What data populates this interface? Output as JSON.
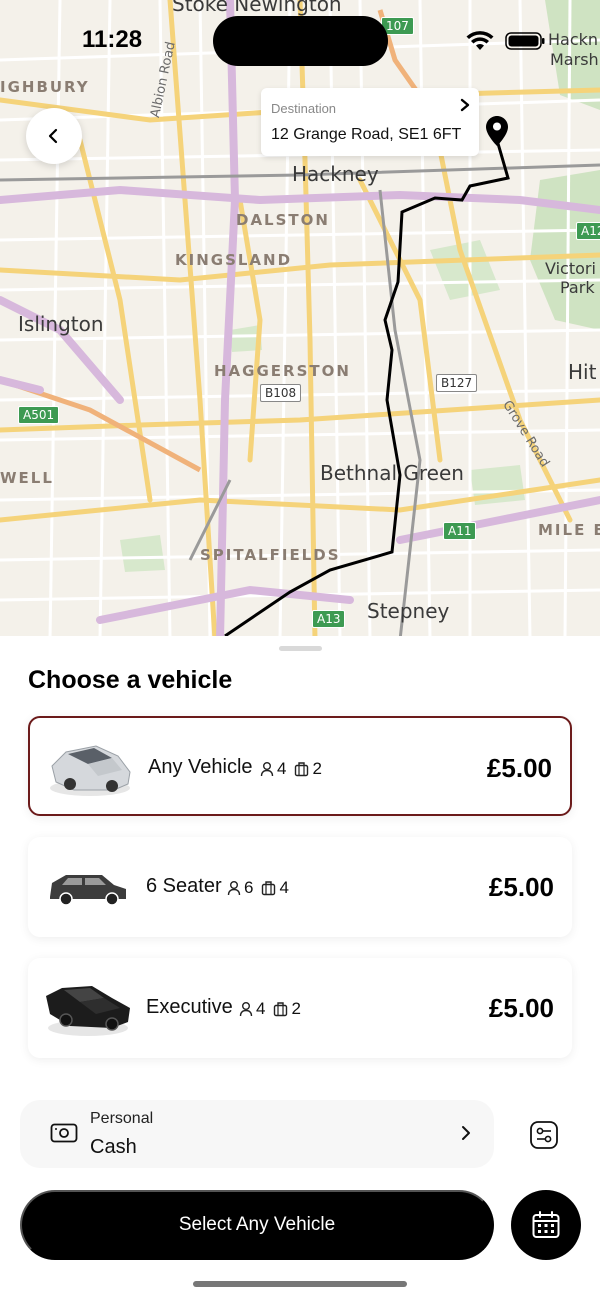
{
  "status_bar": {
    "time": "11:28"
  },
  "map": {
    "places": [
      "Stoke Newington",
      "Hackney",
      "Islington",
      "Bethnal Green",
      "Stepney",
      "Hackn",
      "Marsh",
      "Victori",
      "Park",
      "Hit"
    ],
    "areas": [
      "IGHBURY",
      "DALSTON",
      "KINGSLAND",
      "HAGGERSTON",
      "SPITALFIELDS",
      "WELL",
      "MILE E"
    ],
    "roads": [
      "Albion Road",
      "Grove Road"
    ],
    "badges": [
      "107",
      "B108",
      "B127",
      "A501",
      "A11",
      "A13",
      "A12",
      "A11"
    ]
  },
  "destination": {
    "label": "Destination",
    "value": "12 Grange Road, SE1 6FT"
  },
  "sheet": {
    "title": "Choose a vehicle",
    "vehicles": [
      {
        "name": "Any Vehicle",
        "passengers": "4",
        "luggage": "2",
        "price": "£5.00",
        "selected": true
      },
      {
        "name": "6 Seater",
        "passengers": "6",
        "luggage": "4",
        "price": "£5.00",
        "selected": false
      },
      {
        "name": "Executive",
        "passengers": "4",
        "luggage": "2",
        "price": "£5.00",
        "selected": false
      }
    ],
    "payment": {
      "label": "Personal",
      "value": "Cash"
    },
    "primary_button": "Select Any Vehicle"
  },
  "colors": {
    "selected_border": "#6b1a1a",
    "primary_button": "#000000",
    "map_background": "#f4f1ea"
  },
  "icons": [
    "back-chevron-icon",
    "forward-chevron-icon",
    "map-pin-icon",
    "person-icon",
    "luggage-icon",
    "cash-icon",
    "filter-icon",
    "calendar-icon",
    "wifi-icon",
    "battery-icon"
  ]
}
